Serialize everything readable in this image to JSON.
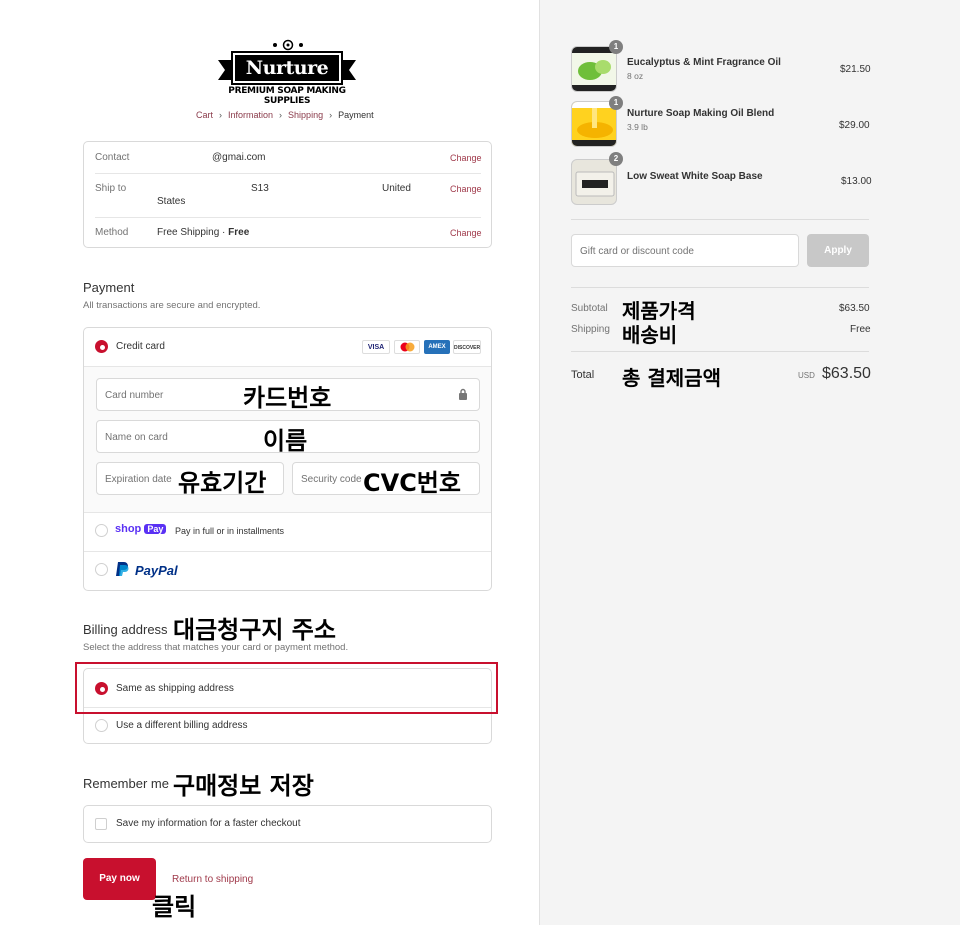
{
  "logo": {
    "name": "Nurture Soap",
    "tagline": "PREMIUM SOAP MAKING SUPPLIES"
  },
  "breadcrumb": [
    {
      "label": "Cart"
    },
    {
      "label": "Information"
    },
    {
      "label": "Shipping"
    },
    {
      "label": "Payment"
    }
  ],
  "info": {
    "contact_label": "Contact",
    "contact_value": "@gmai.com",
    "ship_label": "Ship to",
    "ship_value_a": "S13",
    "ship_value_b": "United",
    "ship_value_c": "States",
    "method_label": "Method",
    "method_value": "Free Shipping · ",
    "method_value_bold": "Free",
    "change": "Change"
  },
  "payment": {
    "title": "Payment",
    "subtitle": "All transactions are secure and encrypted.",
    "credit_card_label": "Credit card",
    "card_brands": [
      "VISA",
      "",
      "AMEX",
      "DISCOVER"
    ],
    "card_number_placeholder": "Card number",
    "name_placeholder": "Name on card",
    "expiry_placeholder": "Expiration date",
    "security_placeholder": "Security code",
    "shoppay_brand": "shop",
    "shoppay_pay": "Pay",
    "shoppay_text": "Pay in full or in installments",
    "paypal_text": "PayPal"
  },
  "billing": {
    "title": "Billing address",
    "subtitle": "Select the address that matches your card or payment method.",
    "same_label": "Same as shipping address",
    "different_label": "Use a different billing address"
  },
  "remember": {
    "title": "Remember me",
    "checkbox_label": "Save my information for a faster checkout"
  },
  "actions": {
    "pay_now": "Pay now",
    "return": "Return to shipping"
  },
  "annotations": {
    "card_number": "카드번호",
    "name": "이름",
    "expiry": "유효기간",
    "security": "CVC번호",
    "billing": "대금청구지 주소",
    "remember": "구매정보 저장",
    "click": "클릭",
    "subtotal": "제품가격",
    "shipping": "배송비",
    "total": "총 결제금액"
  },
  "cart": {
    "items": [
      {
        "qty": "1",
        "name": "Eucalyptus & Mint Fragrance Oil",
        "variant": "8 oz",
        "price": "$21.50"
      },
      {
        "qty": "1",
        "name": "Nurture Soap Making Oil Blend",
        "variant": "3.9 lb",
        "price": "$29.00"
      },
      {
        "qty": "2",
        "name": "Low Sweat White Soap Base",
        "variant": "",
        "price": "$13.00"
      }
    ],
    "discount_placeholder": "Gift card or discount code",
    "apply": "Apply",
    "subtotal_label": "Subtotal",
    "subtotal_value": "$63.50",
    "shipping_label": "Shipping",
    "shipping_value": "Free",
    "total_label": "Total",
    "currency": "USD",
    "total_value": "$63.50"
  },
  "colors": {
    "accent": "#c8102e",
    "link": "#a03a4b",
    "highlight_box": "#c8102e"
  }
}
